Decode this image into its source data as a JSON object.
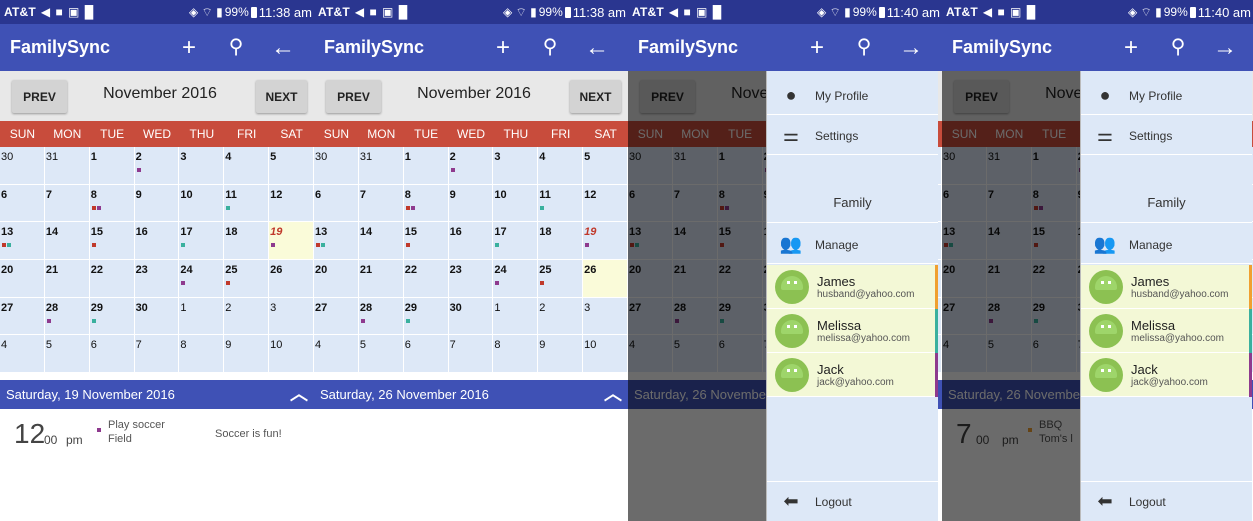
{
  "status": {
    "carrier": "AT&T",
    "battery": "99%",
    "time_a": "11:38 am",
    "time_b": "11:40 am"
  },
  "app": {
    "title": "FamilySync"
  },
  "icons": {
    "add": "plus-icon",
    "search": "search-icon",
    "back": "arrow-left-icon",
    "forward": "arrow-right-icon"
  },
  "calendar": {
    "prev_label": "PREV",
    "next_label": "NEXT",
    "month_label": "November 2016",
    "weekdays": [
      "SUN",
      "MON",
      "TUE",
      "WED",
      "THU",
      "FRI",
      "SAT"
    ],
    "weeks": [
      [
        "30",
        "31",
        "1",
        "2",
        "3",
        "4",
        "5"
      ],
      [
        "6",
        "7",
        "8",
        "9",
        "10",
        "11",
        "12"
      ],
      [
        "13",
        "14",
        "15",
        "16",
        "17",
        "18",
        "19"
      ],
      [
        "20",
        "21",
        "22",
        "23",
        "24",
        "25",
        "26"
      ],
      [
        "27",
        "28",
        "29",
        "30",
        "1",
        "2",
        "3"
      ],
      [
        "4",
        "5",
        "6",
        "7",
        "8",
        "9",
        "10"
      ]
    ],
    "today": "19",
    "event_dots": {
      "2": [
        "#8e3a8e"
      ],
      "8": [
        "#c0392b",
        "#8e3a8e"
      ],
      "11": [
        "#3ab09e"
      ],
      "13": [
        "#c0392b",
        "#3ab09e"
      ],
      "15": [
        "#c0392b"
      ],
      "17": [
        "#3ab09e"
      ],
      "19": [
        "#8e3a8e"
      ],
      "24": [
        "#8e3a8e"
      ],
      "25": [
        "#c0392b"
      ],
      "28": [
        "#8e3a8e"
      ],
      "29": [
        "#3ab09e"
      ]
    }
  },
  "panels": [
    {
      "time": "11:38 am",
      "selected_day": "19",
      "day_label": "Saturday, 19 November 2016",
      "event": {
        "hour": "12",
        "minutes": "00",
        "period": "pm",
        "title": "Play soccer",
        "location": "Field",
        "note": "Soccer is fun!"
      }
    },
    {
      "time": "11:38 am",
      "selected_day": "26",
      "day_label": "Saturday, 26 November 2016",
      "event": null
    },
    {
      "time": "11:40 am",
      "selected_day": "26",
      "day_label": "Saturday, 26 Novembe",
      "event": null,
      "drawer": true
    },
    {
      "time": "11:40 am",
      "selected_day": "26",
      "day_label": "Saturday, 26 Novembe",
      "drawer": true,
      "event": {
        "hour": "7",
        "minutes": "00",
        "period": "pm",
        "title": "BBQ",
        "location": "Tom's l",
        "note": ""
      }
    }
  ],
  "drawer": {
    "profile_label": "My Profile",
    "settings_label": "Settings",
    "family_label": "Family",
    "manage_label": "Manage",
    "logout_label": "Logout",
    "contacts": [
      {
        "name": "James",
        "email": "husband@yahoo.com",
        "color": "#f0a030"
      },
      {
        "name": "Melissa",
        "email": "melissa@yahoo.com",
        "color": "#3ab09e"
      },
      {
        "name": "Jack",
        "email": "jack@yahoo.com",
        "color": "#8e3a8e"
      }
    ]
  },
  "colors": {
    "primary": "#3f51b5",
    "status_bar": "#2a3690",
    "weekday_bar": "#c84c3c",
    "cell_bg": "#dde8f7",
    "highlight": "#fafbd9"
  }
}
